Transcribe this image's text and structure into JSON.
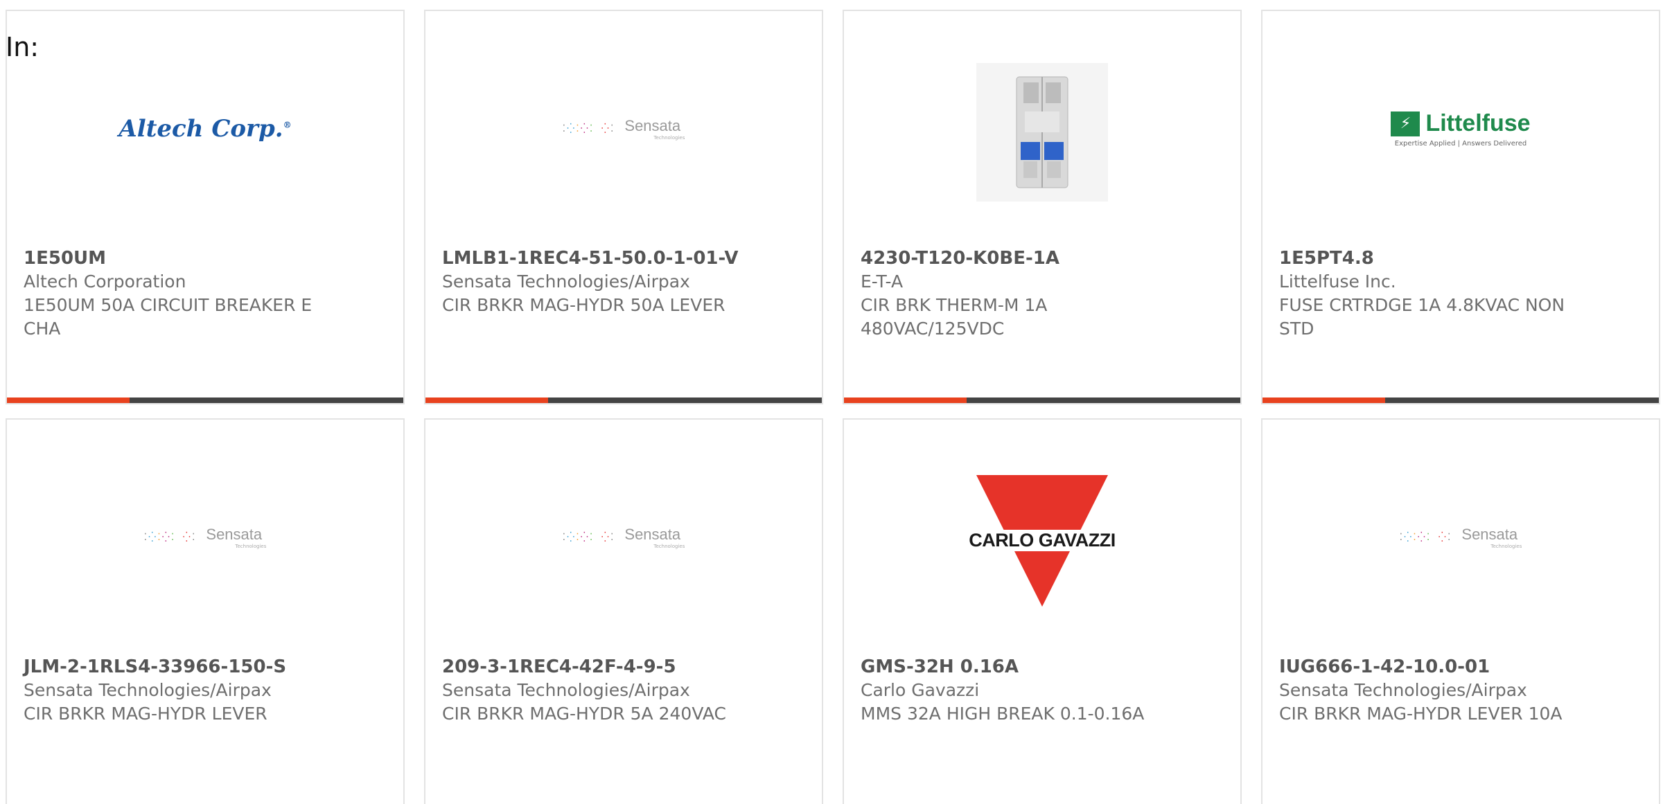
{
  "filter": {
    "label": "In:"
  },
  "products": [
    {
      "part": "1E50UM",
      "manufacturer": "Altech Corporation",
      "description": "1E50UM 50A CIRCUIT BREAKER E CHA",
      "logo": "altech-corp-logo",
      "logo_text": "Altech Corp.",
      "progress": 0.31
    },
    {
      "part": "LMLB1-1REC4-51-50.0-1-01-V",
      "manufacturer": "Sensata Technologies/Airpax",
      "description": "CIR BRKR MAG-HYDR 50A LEVER",
      "logo": "sensata-logo",
      "logo_text": "Sensata",
      "logo_sub": "Technologies",
      "progress": 0.31
    },
    {
      "part": "4230-T120-K0BE-1A",
      "manufacturer": "E-T-A",
      "description": "CIR BRK THERM-M 1A 480VAC/125VDC",
      "logo": "circuit-breaker-photo",
      "progress": 0.31
    },
    {
      "part": "1E5PT4.8",
      "manufacturer": "Littelfuse Inc.",
      "description": "FUSE CRTRDGE 1A 4.8KVAC NON STD",
      "logo": "littelfuse-logo",
      "logo_text": "Littelfuse",
      "logo_sub": "Expertise Applied | Answers Delivered",
      "progress": 0.31
    },
    {
      "part": "JLM-2-1RLS4-33966-150-S",
      "manufacturer": "Sensata Technologies/Airpax",
      "description": "CIR BRKR MAG-HYDR LEVER",
      "logo": "sensata-logo",
      "logo_text": "Sensata",
      "logo_sub": "Technologies"
    },
    {
      "part": "209-3-1REC4-42F-4-9-5",
      "manufacturer": "Sensata Technologies/Airpax",
      "description": "CIR BRKR MAG-HYDR 5A 240VAC",
      "logo": "sensata-logo",
      "logo_text": "Sensata",
      "logo_sub": "Technologies"
    },
    {
      "part": "GMS-32H 0.16A",
      "manufacturer": "Carlo Gavazzi",
      "description": "MMS 32A HIGH BREAK 0.1-0.16A",
      "logo": "carlo-gavazzi-logo",
      "logo_text": "CARLO GAVAZZI"
    },
    {
      "part": "IUG666-1-42-10.0-01",
      "manufacturer": "Sensata Technologies/Airpax",
      "description": "CIR BRKR MAG-HYDR LEVER 10A",
      "logo": "sensata-logo",
      "logo_text": "Sensata",
      "logo_sub": "Technologies"
    }
  ],
  "colors": {
    "accent": "#e8421e",
    "bar": "#444444",
    "altech_blue": "#1c5aa6",
    "littelfuse_green": "#1f8a4c",
    "gavazzi_red": "#e63329"
  }
}
